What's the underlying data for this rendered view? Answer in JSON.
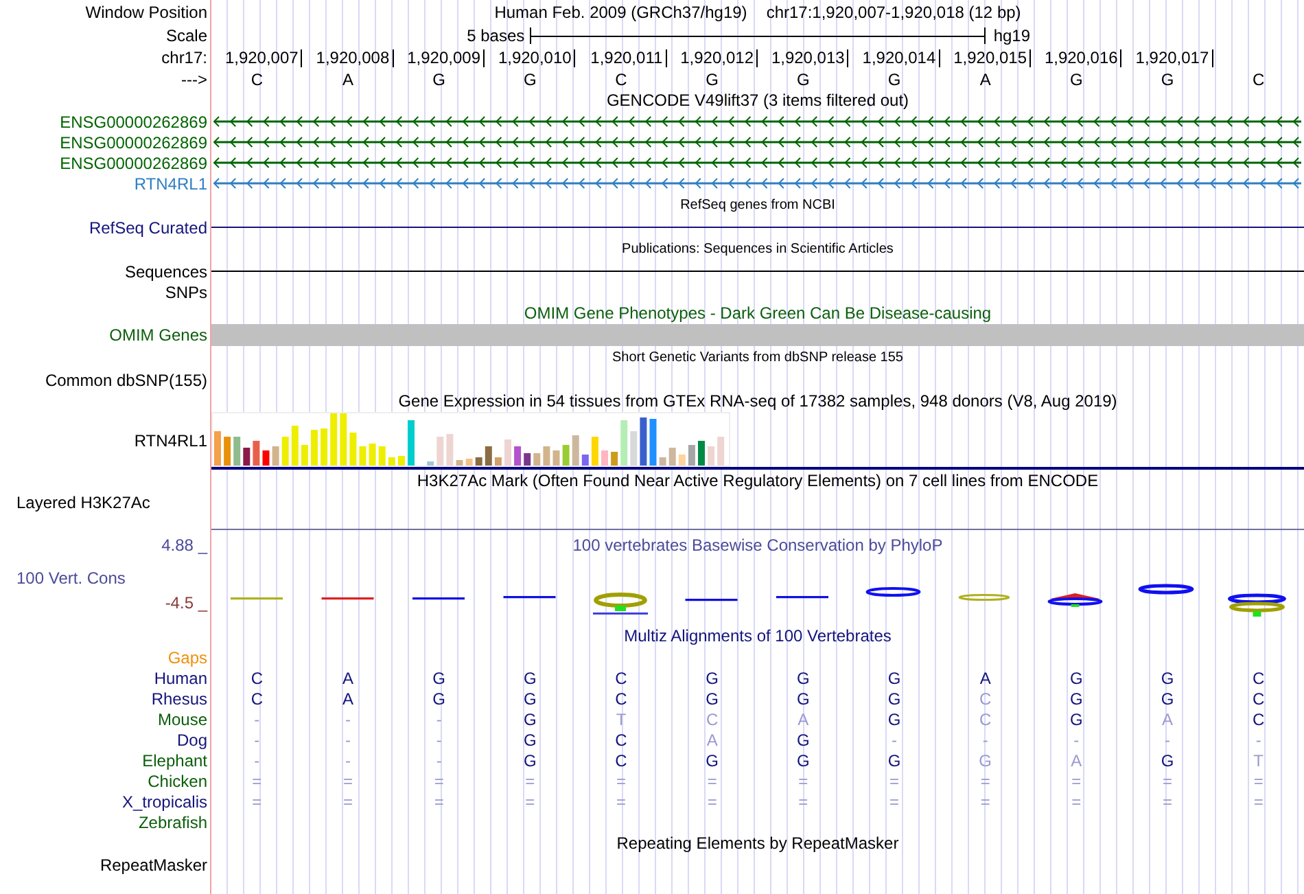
{
  "rows": [
    {
      "kind": "header",
      "label": "Window Position",
      "title": "Human Feb. 2009 (GRCh37/hg19)",
      "position": "chr17:1,920,007-1,920,018 (12 bp)"
    },
    {
      "kind": "scale",
      "label": "Scale",
      "text": "5 bases",
      "assembly": "hg19"
    },
    {
      "kind": "ruler",
      "label": "chr17:",
      "ticks": [
        "1,920,007",
        "1,920,008",
        "1,920,009",
        "1,920,010",
        "1,920,011",
        "1,920,012",
        "1,920,013",
        "1,920,014",
        "1,920,015",
        "1,920,016",
        "1,920,017"
      ]
    },
    {
      "kind": "bases",
      "label": "--->",
      "bases": [
        "C",
        "A",
        "G",
        "G",
        "C",
        "G",
        "G",
        "G",
        "A",
        "G",
        "G",
        "C"
      ]
    },
    {
      "kind": "title",
      "text": "GENCODE V49lift37 (3 items filtered out)",
      "color": "#000000"
    },
    {
      "kind": "gene",
      "label": "ENSG00000262869",
      "color": "#006400"
    },
    {
      "kind": "gene",
      "label": "ENSG00000262869",
      "color": "#006400"
    },
    {
      "kind": "gene",
      "label": "ENSG00000262869",
      "color": "#006400"
    },
    {
      "kind": "gene",
      "label": "RTN4RL1",
      "color": "#2e7fc2"
    },
    {
      "kind": "caption",
      "text": "RefSeq genes from NCBI"
    },
    {
      "kind": "line",
      "label": "RefSeq Curated",
      "color": "#14147c"
    },
    {
      "kind": "caption",
      "text": "Publications: Sequences in Scientific Articles"
    },
    {
      "kind": "line",
      "label": "Sequences",
      "color": "#000000"
    },
    {
      "kind": "label",
      "label": "SNPs"
    },
    {
      "kind": "title",
      "text": "OMIM Gene Phenotypes - Dark Green Can Be Disease-causing",
      "color": "#0b5e0b"
    },
    {
      "kind": "bar",
      "label": "OMIM Genes",
      "color": "#0b5e0b"
    },
    {
      "kind": "caption",
      "text": "Short Genetic Variants from dbSNP release 155"
    },
    {
      "kind": "label",
      "label": "Common dbSNP(155)"
    },
    {
      "kind": "title",
      "text": "Gene Expression in 54 tissues from GTEx RNA-seq of 17382 samples, 948 donors (V8, Aug 2019)",
      "color": "#000000"
    },
    {
      "kind": "expression",
      "label": "RTN4RL1"
    },
    {
      "kind": "title",
      "text": "H3K27Ac Mark (Often Found Near Active Regulatory Elements) on 7 cell lines from ENCODE",
      "color": "#000000"
    },
    {
      "kind": "layered",
      "label": "Layered H3K27Ac"
    },
    {
      "kind": "conservation",
      "max": "4.88 _",
      "label": "100 Vert. Cons",
      "min": "-4.5 _",
      "title": "100 vertebrates Basewise Conservation by PhyloP"
    },
    {
      "kind": "title",
      "text": "Multiz Alignments of 100 Vertebrates",
      "color": "#14147c"
    },
    {
      "kind": "gaps",
      "label": "Gaps",
      "color": "#f0900c"
    },
    {
      "kind": "species",
      "label": "Human",
      "color": "#14147c",
      "cells": [
        {
          "base": "C",
          "faded": false
        },
        {
          "base": "A",
          "faded": false
        },
        {
          "base": "G",
          "faded": false
        },
        {
          "base": "G",
          "faded": false
        },
        {
          "base": "C",
          "faded": false
        },
        {
          "base": "G",
          "faded": false
        },
        {
          "base": "G",
          "faded": false
        },
        {
          "base": "G",
          "faded": false
        },
        {
          "base": "A",
          "faded": false
        },
        {
          "base": "G",
          "faded": false
        },
        {
          "base": "G",
          "faded": false
        },
        {
          "base": "C",
          "faded": false
        }
      ]
    },
    {
      "kind": "species",
      "label": "Rhesus",
      "color": "#14147c",
      "cells": [
        {
          "base": "C",
          "faded": false
        },
        {
          "base": "A",
          "faded": false
        },
        {
          "base": "G",
          "faded": false
        },
        {
          "base": "G",
          "faded": false
        },
        {
          "base": "C",
          "faded": false
        },
        {
          "base": "G",
          "faded": false
        },
        {
          "base": "G",
          "faded": false
        },
        {
          "base": "G",
          "faded": false
        },
        {
          "base": "C",
          "faded": true
        },
        {
          "base": "G",
          "faded": false
        },
        {
          "base": "G",
          "faded": false
        },
        {
          "base": "C",
          "faded": false
        }
      ]
    },
    {
      "kind": "species",
      "label": "Mouse",
      "color": "#0b5e0b",
      "cells": [
        {
          "base": "-",
          "faded": true
        },
        {
          "base": "-",
          "faded": true
        },
        {
          "base": "-",
          "faded": true
        },
        {
          "base": "G",
          "faded": false
        },
        {
          "base": "T",
          "faded": true
        },
        {
          "base": "C",
          "faded": true
        },
        {
          "base": "A",
          "faded": true
        },
        {
          "base": "G",
          "faded": false
        },
        {
          "base": "C",
          "faded": true
        },
        {
          "base": "G",
          "faded": false
        },
        {
          "base": "A",
          "faded": true
        },
        {
          "base": "C",
          "faded": false
        }
      ]
    },
    {
      "kind": "species",
      "label": "Dog",
      "color": "#14147c",
      "cells": [
        {
          "base": "-",
          "faded": true
        },
        {
          "base": "-",
          "faded": true
        },
        {
          "base": "-",
          "faded": true
        },
        {
          "base": "G",
          "faded": false
        },
        {
          "base": "C",
          "faded": false
        },
        {
          "base": "A",
          "faded": true
        },
        {
          "base": "G",
          "faded": false
        },
        {
          "base": "-",
          "faded": true
        },
        {
          "base": "-",
          "faded": true
        },
        {
          "base": "-",
          "faded": true
        },
        {
          "base": "-",
          "faded": true
        },
        {
          "base": "-",
          "faded": true
        }
      ]
    },
    {
      "kind": "species",
      "label": "Elephant",
      "color": "#0b5e0b",
      "cells": [
        {
          "base": "-",
          "faded": true
        },
        {
          "base": "-",
          "faded": true
        },
        {
          "base": "-",
          "faded": true
        },
        {
          "base": "G",
          "faded": false
        },
        {
          "base": "C",
          "faded": false
        },
        {
          "base": "G",
          "faded": false
        },
        {
          "base": "G",
          "faded": false
        },
        {
          "base": "G",
          "faded": false
        },
        {
          "base": "G",
          "faded": true
        },
        {
          "base": "A",
          "faded": true
        },
        {
          "base": "G",
          "faded": false
        },
        {
          "base": "T",
          "faded": true
        }
      ]
    },
    {
      "kind": "species",
      "label": "Chicken",
      "color": "#0b5e0b",
      "cells": [
        {
          "base": "=",
          "faded": true
        },
        {
          "base": "=",
          "faded": true
        },
        {
          "base": "=",
          "faded": true
        },
        {
          "base": "=",
          "faded": true
        },
        {
          "base": "=",
          "faded": true
        },
        {
          "base": "=",
          "faded": true
        },
        {
          "base": "=",
          "faded": true
        },
        {
          "base": "=",
          "faded": true
        },
        {
          "base": "=",
          "faded": true
        },
        {
          "base": "=",
          "faded": true
        },
        {
          "base": "=",
          "faded": true
        },
        {
          "base": "=",
          "faded": true
        }
      ]
    },
    {
      "kind": "species",
      "label": "X_tropicalis",
      "color": "#14147c",
      "cells": [
        {
          "base": "=",
          "faded": true
        },
        {
          "base": "=",
          "faded": true
        },
        {
          "base": "=",
          "faded": true
        },
        {
          "base": "=",
          "faded": true
        },
        {
          "base": "=",
          "faded": true
        },
        {
          "base": "=",
          "faded": true
        },
        {
          "base": "=",
          "faded": true
        },
        {
          "base": "=",
          "faded": true
        },
        {
          "base": "=",
          "faded": true
        },
        {
          "base": "=",
          "faded": true
        },
        {
          "base": "=",
          "faded": true
        },
        {
          "base": "=",
          "faded": true
        }
      ]
    },
    {
      "kind": "species",
      "label": "Zebrafish",
      "color": "#0b5e0b"
    },
    {
      "kind": "title",
      "text": "Repeating Elements by RepeatMasker",
      "color": "#000000"
    },
    {
      "kind": "label",
      "label": "RepeatMasker"
    }
  ]
}
